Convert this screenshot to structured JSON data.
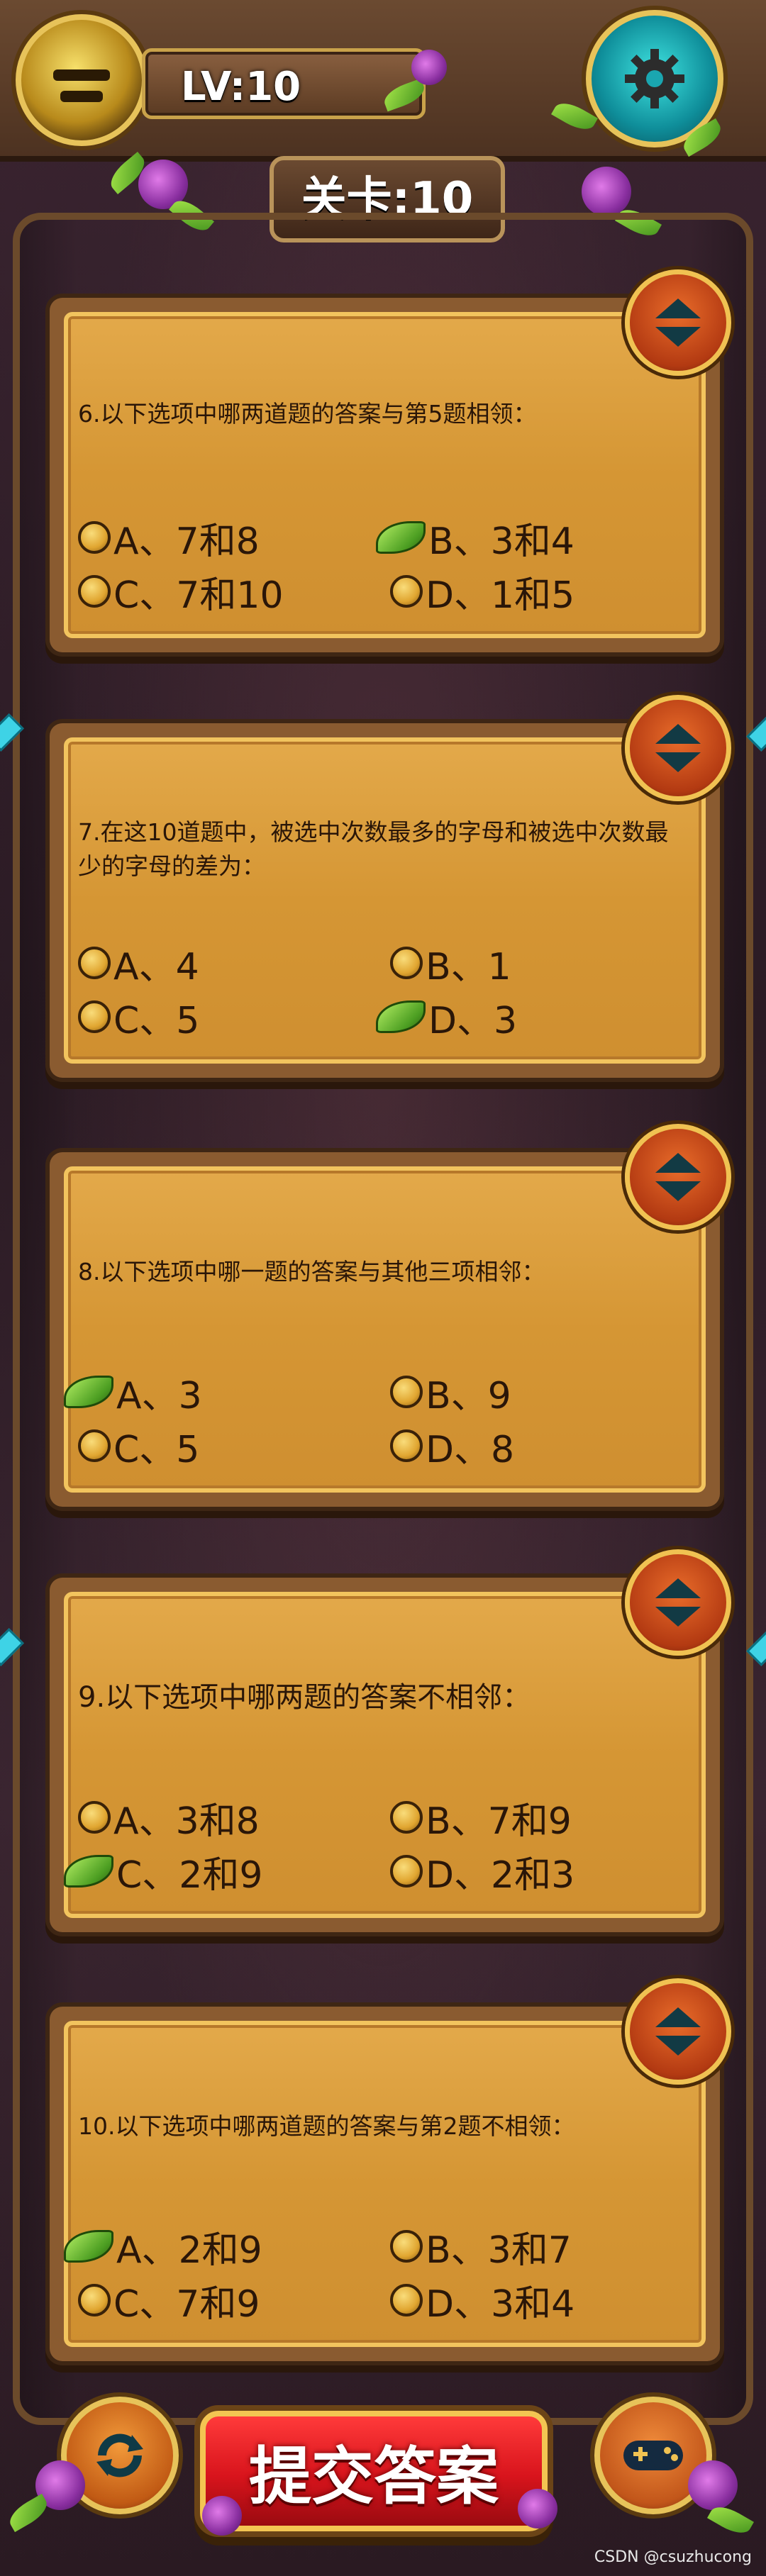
{
  "header": {
    "level_label": "LV:10",
    "stage_title": "关卡:10"
  },
  "questions": [
    {
      "text": "6.以下选项中哪两道题的答案与第5题相领：",
      "options": [
        {
          "label": "A、7和8",
          "selected": false
        },
        {
          "label": "B、3和4",
          "selected": true
        },
        {
          "label": "C、7和10",
          "selected": false
        },
        {
          "label": "D、1和5",
          "selected": false
        }
      ]
    },
    {
      "text": "7.在这10道题中，被选中次数最多的字母和被选中次数最少的字母的差为：",
      "options": [
        {
          "label": "A、4",
          "selected": false
        },
        {
          "label": "B、1",
          "selected": false
        },
        {
          "label": "C、5",
          "selected": false
        },
        {
          "label": "D、3",
          "selected": true
        }
      ]
    },
    {
      "text": "8.以下选项中哪一题的答案与其他三项相邻：",
      "options": [
        {
          "label": "A、3",
          "selected": true
        },
        {
          "label": "B、9",
          "selected": false
        },
        {
          "label": "C、5",
          "selected": false
        },
        {
          "label": "D、8",
          "selected": false
        }
      ]
    },
    {
      "text": "9.以下选项中哪两题的答案不相邻：",
      "options": [
        {
          "label": "A、3和8",
          "selected": false
        },
        {
          "label": "B、7和9",
          "selected": false
        },
        {
          "label": "C、2和9",
          "selected": true
        },
        {
          "label": "D、2和3",
          "selected": false
        }
      ]
    },
    {
      "text": "10.以下选项中哪两道题的答案与第2题不相领：",
      "options": [
        {
          "label": "A、2和9",
          "selected": true
        },
        {
          "label": "B、3和7",
          "selected": false
        },
        {
          "label": "C、7和9",
          "selected": false
        },
        {
          "label": "D、3和4",
          "selected": false
        }
      ]
    }
  ],
  "footer": {
    "submit_label": "提交答案",
    "watermark": "CSDN @csuzhucong"
  },
  "icons": {
    "avatar": "knight-helmet-icon",
    "settings": "gear-icon",
    "collapse": "chevron-up-down-icon",
    "refresh": "refresh-icon",
    "gamepad": "gamepad-icon",
    "selected_option": "leaf-icon"
  },
  "colors": {
    "submit_bg": "#d8141c",
    "card_paper": "#d59634",
    "settings_teal": "#0f8e9a"
  }
}
